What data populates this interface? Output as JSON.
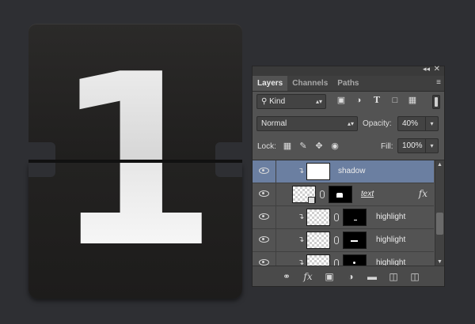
{
  "artwork": {
    "digit": "1"
  },
  "panel": {
    "collapse_glyph": "◂◂",
    "close_glyph": "✕",
    "tabs": [
      {
        "label": "Layers",
        "active": true
      },
      {
        "label": "Channels",
        "active": false
      },
      {
        "label": "Paths",
        "active": false
      }
    ],
    "menu_glyph": "≡"
  },
  "filter": {
    "label": "Kind",
    "icons": [
      "image-filter-icon",
      "adjustment-filter-icon",
      "type-filter-icon",
      "shape-filter-icon",
      "smart-object-filter-icon"
    ]
  },
  "blend": {
    "mode": "Normal",
    "opacity_label": "Opacity:",
    "opacity_value": "40%"
  },
  "lock": {
    "label": "Lock:",
    "fill_label": "Fill:",
    "fill_value": "100%"
  },
  "layers": [
    {
      "name": "shadow",
      "selected": true,
      "clipped": true
    },
    {
      "name": "text",
      "selected": false,
      "clipped": false,
      "fx": "fx"
    },
    {
      "name": "highlight",
      "selected": false,
      "clipped": true
    },
    {
      "name": "highlight",
      "selected": false,
      "clipped": true
    },
    {
      "name": "highlight",
      "selected": false,
      "clipped": true
    }
  ],
  "footer_icons": [
    "link-layers-icon",
    "fx-icon",
    "add-mask-icon",
    "adjustment-layer-icon",
    "new-group-icon",
    "new-layer-icon",
    "trash-icon"
  ]
}
